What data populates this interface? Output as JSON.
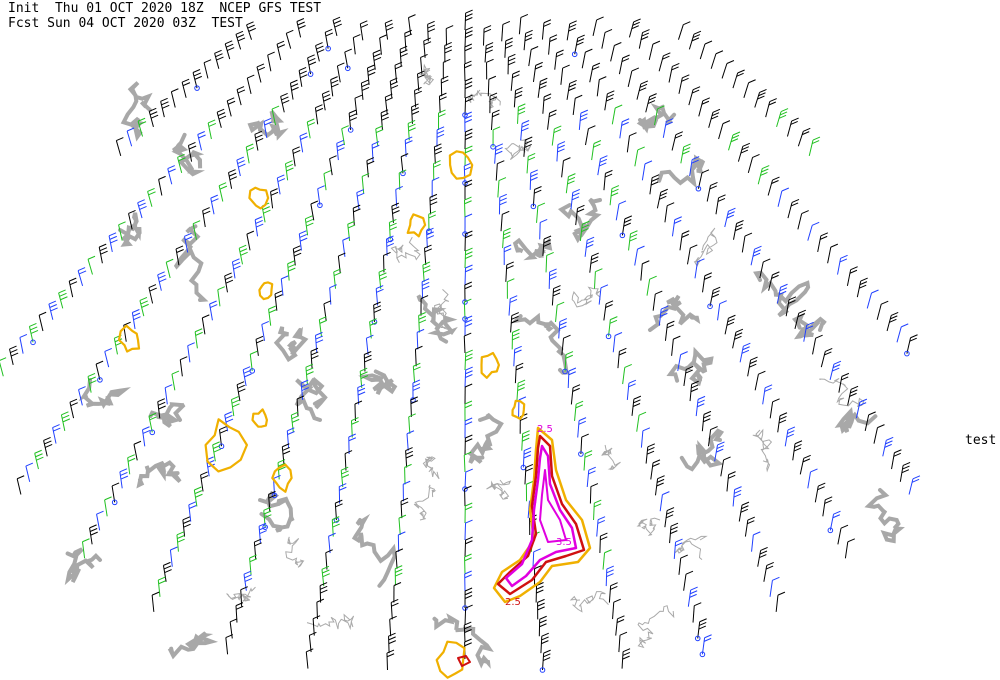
{
  "header": {
    "line1": "Init  Thu 01 OCT 2020 18Z  NCEP GFS TEST",
    "line2": "Fcst Sun 04 OCT 2020 03Z  TEST"
  },
  "side_label": "test",
  "contour_labels": [
    {
      "text": "3.5",
      "color": "#e000e0"
    },
    {
      "text": "2.5",
      "color": "#d01010"
    },
    {
      "text": "2.5",
      "color": "#e000e0"
    }
  ],
  "colors": {
    "coastline": "#aaaaaa",
    "thick_contour": "#a8a8a8",
    "level1": "#f0b000",
    "level2": "#d01010",
    "level3": "#e000e0",
    "barb_black": "#000000",
    "barb_green": "#20c020",
    "barb_blue": "#2040ff"
  }
}
